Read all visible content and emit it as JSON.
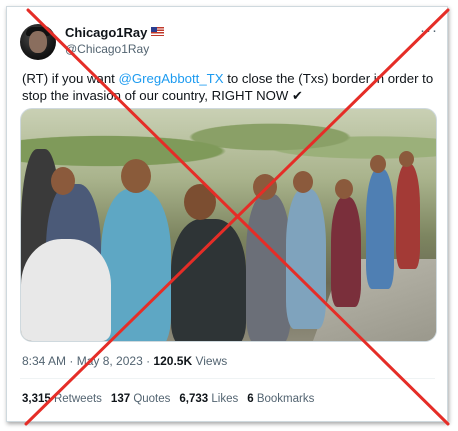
{
  "author": {
    "display_name": "Chicago1Ray",
    "flag": "US flag",
    "handle": "@Chicago1Ray"
  },
  "tweet": {
    "text_before": "(RT) if you want ",
    "mention": "@GregAbbott_TX",
    "text_after": " to close the (Txs) border in order to stop the invasion of our country, RIGHT NOW ",
    "check_mark": "✔"
  },
  "meta": {
    "time": "8:34 AM",
    "separator": " · ",
    "date": "May 8, 2023",
    "separator2": " · ",
    "views_count": "120.5K",
    "views_label": " Views"
  },
  "stats": {
    "retweets_count": "3,315",
    "retweets_label": "Retweets",
    "quotes_count": "137",
    "quotes_label": "Quotes",
    "likes_count": "6,733",
    "likes_label": "Likes",
    "bookmarks_count": "6",
    "bookmarks_label": "Bookmarks"
  },
  "overlay": {
    "cross_color": "#e52d27"
  },
  "icons": {
    "more": "more-options-icon",
    "avatar": "avatar"
  }
}
